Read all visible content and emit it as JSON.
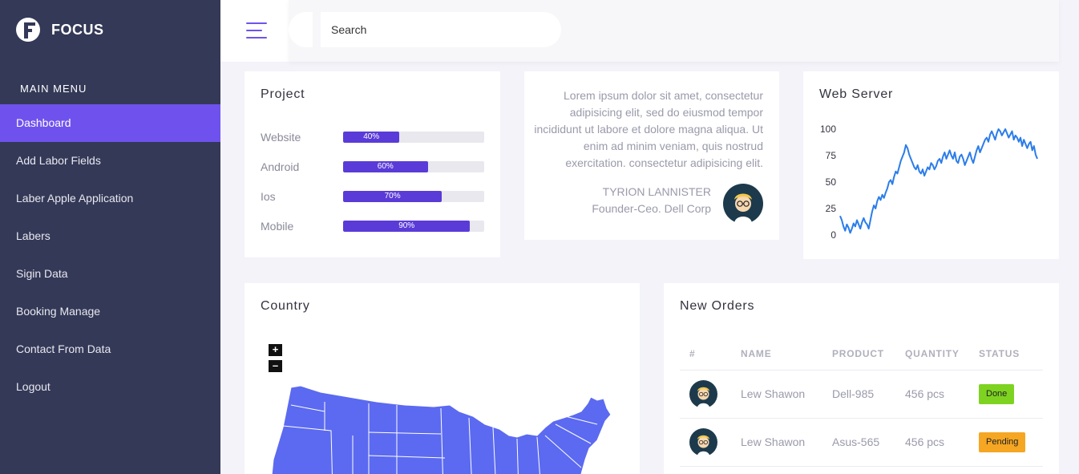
{
  "app": {
    "brand": "FOCUS"
  },
  "sidebar": {
    "heading": "MAIN MENU",
    "items": [
      {
        "label": "Dashboard",
        "active": true
      },
      {
        "label": "Add Labor Fields"
      },
      {
        "label": "Laber Apple Application"
      },
      {
        "label": "Labers"
      },
      {
        "label": "Sigin Data"
      },
      {
        "label": "Booking Manage"
      },
      {
        "label": "Contact From Data"
      },
      {
        "label": "Logout"
      }
    ]
  },
  "header": {
    "search_placeholder": "Search"
  },
  "project": {
    "title": "Project",
    "items": [
      {
        "label": "Website",
        "value": 0.4,
        "display": "40%"
      },
      {
        "label": "Android",
        "value": 0.6,
        "display": "60%"
      },
      {
        "label": "Ios",
        "value": 0.7,
        "display": "70%"
      },
      {
        "label": "Mobile",
        "value": 0.9,
        "display": "90%"
      }
    ]
  },
  "testimonial": {
    "text": "Lorem ipsum dolor sit amet, consectetur adipisicing elit, sed do eiusmod tempor incididunt ut labore et dolore magna aliqua. Ut enim ad minim veniam, quis nostrud exercitation. consectetur adipisicing elit.",
    "name": "TYRION LANNISTER",
    "role": "Founder-Ceo. Dell Corp"
  },
  "web_server": {
    "title": "Web Server"
  },
  "chart_data": {
    "type": "line",
    "title": "Web Server",
    "xlabel": "",
    "ylabel": "",
    "ylim": [
      0,
      100
    ],
    "yticks": [
      "100",
      "75",
      "50",
      "25",
      "0"
    ],
    "grid": false,
    "color": "#2b7de9",
    "values": [
      18,
      14,
      8,
      4,
      10,
      7,
      2,
      6,
      11,
      8,
      14,
      10,
      6,
      12,
      16,
      12,
      10,
      6,
      14,
      22,
      28,
      25,
      32,
      36,
      33,
      38,
      35,
      40,
      44,
      50,
      52,
      48,
      55,
      60,
      58,
      64,
      70,
      74,
      78,
      85,
      82,
      76,
      72,
      68,
      64,
      62,
      66,
      60,
      58,
      62,
      56,
      60,
      64,
      62,
      68,
      66,
      62,
      65,
      70,
      72,
      68,
      74,
      78,
      72,
      76,
      80,
      75,
      72,
      78,
      70,
      68,
      74,
      76,
      72,
      66,
      70,
      74,
      78,
      72,
      68,
      74,
      80,
      84,
      78,
      82,
      86,
      90,
      92,
      88,
      95,
      98,
      94,
      90,
      96,
      100,
      98,
      94,
      97,
      100,
      96,
      92,
      95,
      98,
      90,
      94,
      92,
      88,
      92,
      84,
      90,
      86,
      82,
      86,
      88,
      80,
      84,
      76,
      72
    ]
  },
  "country": {
    "title": "Country",
    "zoom_in": "+",
    "zoom_out": "–"
  },
  "orders": {
    "title": "New Orders",
    "columns": [
      "#",
      "NAME",
      "PRODUCT",
      "QUANTITY",
      "STATUS"
    ],
    "rows": [
      {
        "name": "Lew Shawon",
        "product": "Dell-985",
        "quantity": "456 pcs",
        "status": "Done",
        "status_color": "#7ed321"
      },
      {
        "name": "Lew Shawon",
        "product": "Asus-565",
        "quantity": "456 pcs",
        "status": "Pending",
        "status_color": "#f5a623"
      }
    ]
  }
}
